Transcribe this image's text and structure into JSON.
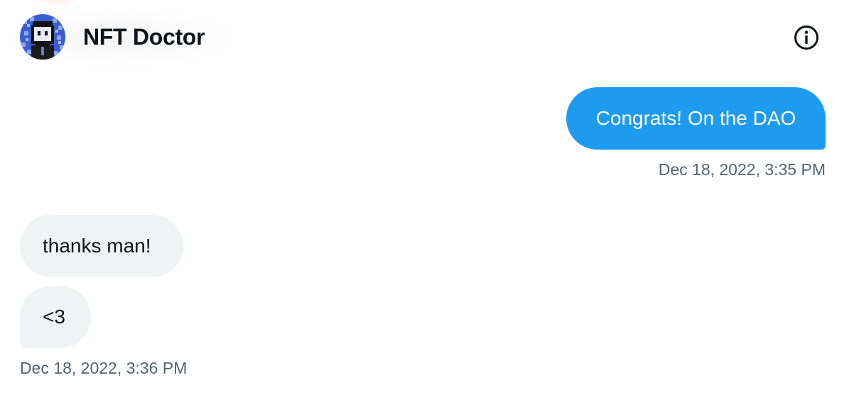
{
  "header": {
    "contact_name": "NFT Doctor",
    "avatar_icon": "pixel-art-avatar-icon",
    "info_icon": "info-circle-icon"
  },
  "messages": [
    {
      "direction": "sent",
      "text": "Congrats! On the DAO"
    },
    {
      "direction": "received",
      "text": "thanks man!"
    },
    {
      "direction": "received",
      "text": "<3"
    }
  ],
  "timestamps": {
    "sent": "Dec 18, 2022, 3:35 PM",
    "received": "Dec 18, 2022, 3:36 PM"
  },
  "colors": {
    "sent_bubble": "#1d9bf0",
    "received_bubble": "#eff3f4",
    "timestamp_text": "#536471",
    "primary_text": "#0f1419"
  }
}
